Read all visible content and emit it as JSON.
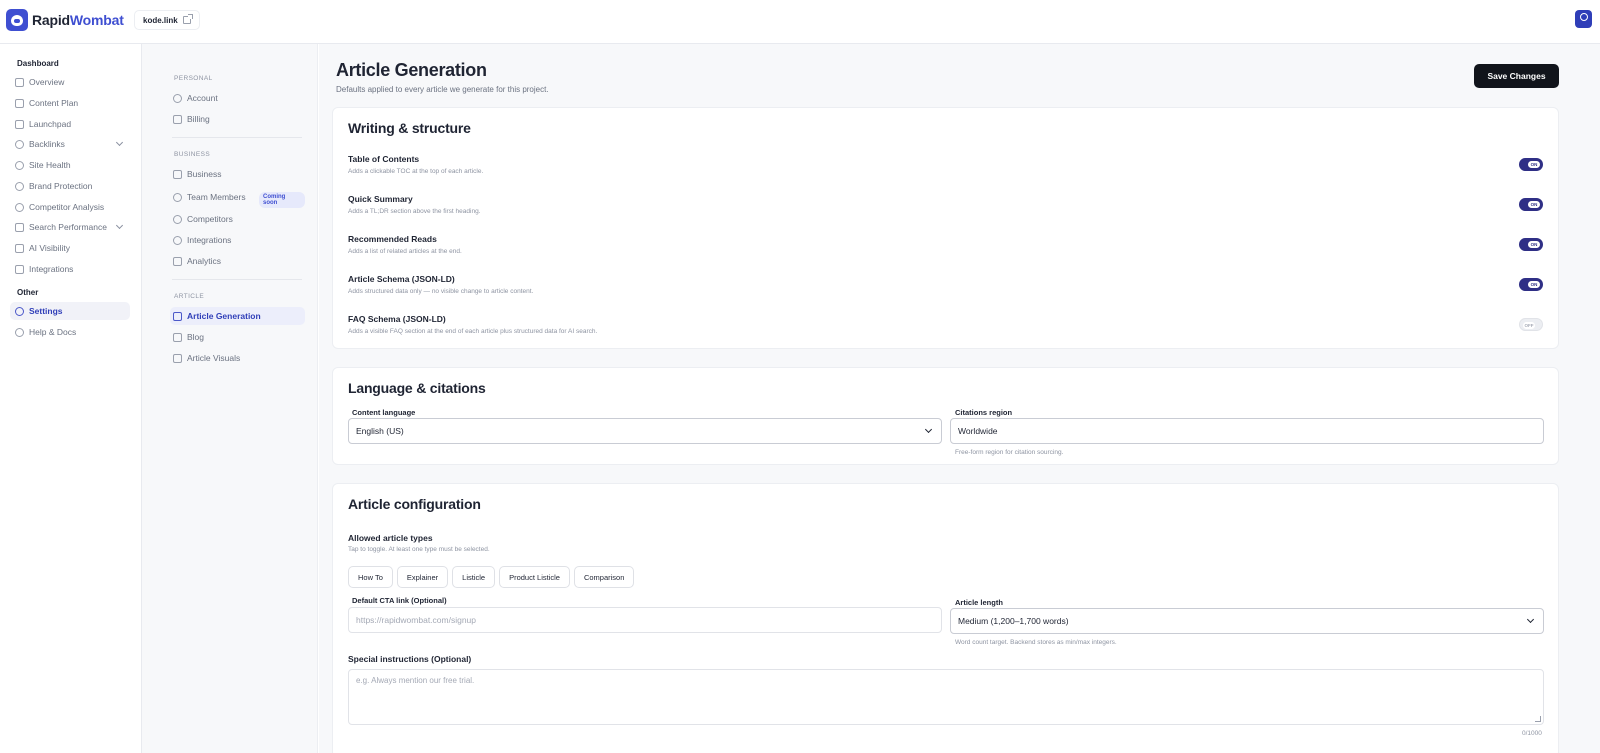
{
  "app": {
    "logo_part1": "Rapid",
    "logo_part2": "Wombat",
    "domain": "kode.link"
  },
  "sidebar": {
    "section_main": "Dashboard",
    "items": [
      {
        "label": "Overview",
        "icon": "home-icon"
      },
      {
        "label": "Content Plan",
        "icon": "calendar-icon"
      },
      {
        "label": "Launchpad",
        "icon": "trend-icon"
      },
      {
        "label": "Backlinks",
        "icon": "link-icon"
      },
      {
        "label": "Site Health",
        "icon": "search-health-icon"
      },
      {
        "label": "Brand Protection",
        "icon": "shield-icon"
      },
      {
        "label": "Competitor Analysis",
        "icon": "radar-icon"
      },
      {
        "label": "Search Performance",
        "icon": "bar-chart-icon"
      },
      {
        "label": "AI Visibility",
        "icon": "sparkle-icon"
      },
      {
        "label": "Integrations",
        "icon": "plug-icon"
      }
    ],
    "section_other": "Other",
    "other_items": [
      {
        "label": "Settings",
        "icon": "gear-icon"
      },
      {
        "label": "Help & Docs",
        "icon": "help-icon"
      }
    ]
  },
  "settings_nav": {
    "personal_heading": "PERSONAL",
    "personal": [
      {
        "label": "Account"
      },
      {
        "label": "Billing"
      }
    ],
    "business_heading": "BUSINESS",
    "business": [
      {
        "label": "Business"
      },
      {
        "label": "Team Members",
        "badge": "Coming soon"
      },
      {
        "label": "Competitors"
      },
      {
        "label": "Integrations"
      },
      {
        "label": "Analytics"
      }
    ],
    "article_heading": "ARTICLE",
    "article": [
      {
        "label": "Article Generation"
      },
      {
        "label": "Blog"
      },
      {
        "label": "Article Visuals"
      }
    ]
  },
  "page": {
    "title": "Article Generation",
    "subtitle": "Defaults applied to every article we generate for this project.",
    "save_label": "Save Changes"
  },
  "writing": {
    "title": "Writing & structure",
    "options": [
      {
        "title": "Table of Contents",
        "desc": "Adds a clickable TOC at the top of each article.",
        "state": "ON"
      },
      {
        "title": "Quick Summary",
        "desc": "Adds a TL;DR section above the first heading.",
        "state": "ON"
      },
      {
        "title": "Recommended Reads",
        "desc": "Adds a list of related articles at the end.",
        "state": "ON"
      },
      {
        "title": "Article Schema (JSON-LD)",
        "desc": "Adds structured data only — no visible change to article content.",
        "state": "ON"
      },
      {
        "title": "FAQ Schema (JSON-LD)",
        "desc": "Adds a visible FAQ section at the end of each article plus structured data for AI search.",
        "state": "OFF"
      }
    ]
  },
  "language": {
    "title": "Language & citations",
    "content_language_label": "Content language",
    "content_language_value": "English (US)",
    "citations_region_label": "Citations region",
    "citations_region_value": "Worldwide",
    "citations_hint": "Free-form region for citation sourcing."
  },
  "config": {
    "title": "Article configuration",
    "types_label": "Allowed article types",
    "types_hint": "Tap to toggle. At least one type must be selected.",
    "types": [
      "How To",
      "Explainer",
      "Listicle",
      "Product Listicle",
      "Comparison"
    ],
    "cta_label": "Default CTA link (Optional)",
    "cta_placeholder": "https://rapidwombat.com/signup",
    "length_label": "Article length",
    "length_value": "Medium (1,200–1,700 words)",
    "length_hint": "Word count target. Backend stores as min/max integers.",
    "instructions_label": "Special instructions (Optional)",
    "instructions_placeholder": "e.g. Always mention our free trial.",
    "char_count": "0/1000"
  },
  "colors": {
    "accent": "#3f4fd1",
    "toggle_on": "#2f2f86",
    "primary_button": "#11141b"
  }
}
